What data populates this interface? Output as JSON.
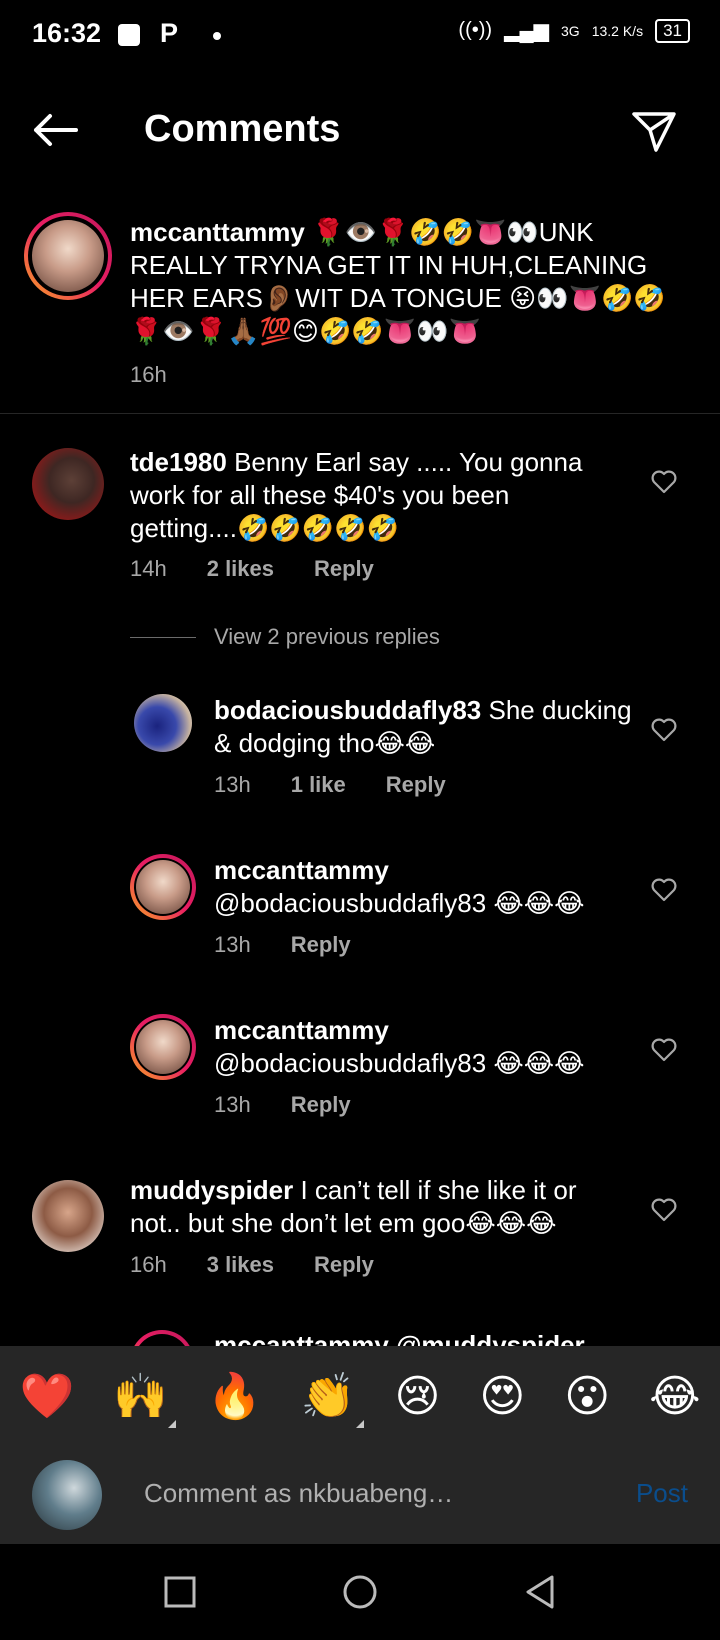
{
  "status": {
    "time": "16:32",
    "app_letter": "P",
    "net": "3G",
    "speed": "13.2 K/s",
    "battery": "31"
  },
  "header": {
    "title": "Comments"
  },
  "caption": {
    "user": "mccanttammy",
    "text": "🌹👁️🌹🤣🤣👅👀UNK REALLY TRYNA GET IT IN HUH,CLEANING HER EARS👂🏾WIT DA TONGUE 😝👀👅🤣🤣🌹👁️🌹🙏🏾💯😊🤣🤣👅👀👅",
    "time": "16h"
  },
  "comments": [
    {
      "user": "tde1980",
      "text": "Benny Earl say ..... You gonna work for all these $40's you been getting....🤣🤣🤣🤣🤣",
      "time": "14h",
      "likes": "2 likes",
      "reply": "Reply"
    },
    {
      "user": "bodaciousbuddafly83",
      "text": "She ducking & dodging tho😂😂",
      "time": "13h",
      "likes": "1 like",
      "reply": "Reply"
    },
    {
      "user": "mccanttammy",
      "text": "@bodaciousbuddafly83 😂😂😂",
      "time": "13h",
      "reply": "Reply"
    },
    {
      "user": "mccanttammy",
      "text": "@bodaciousbuddafly83 😂😂😂",
      "time": "13h",
      "reply": "Reply"
    },
    {
      "user": "muddyspider",
      "text": "I can’t tell if she like it or not.. but she don’t let em goo😂😂😂",
      "time": "16h",
      "likes": "3 likes",
      "reply": "Reply"
    }
  ],
  "view_previous": "View 2 previous replies",
  "partial_comment": "mccanttammy @muddyspider",
  "emoji_bar": [
    "❤️",
    "🙌",
    "🔥",
    "👏",
    "😢",
    "😍",
    "😮",
    "😂"
  ],
  "input": {
    "placeholder": "Comment as nkbuabeng…",
    "post_label": "Post"
  }
}
